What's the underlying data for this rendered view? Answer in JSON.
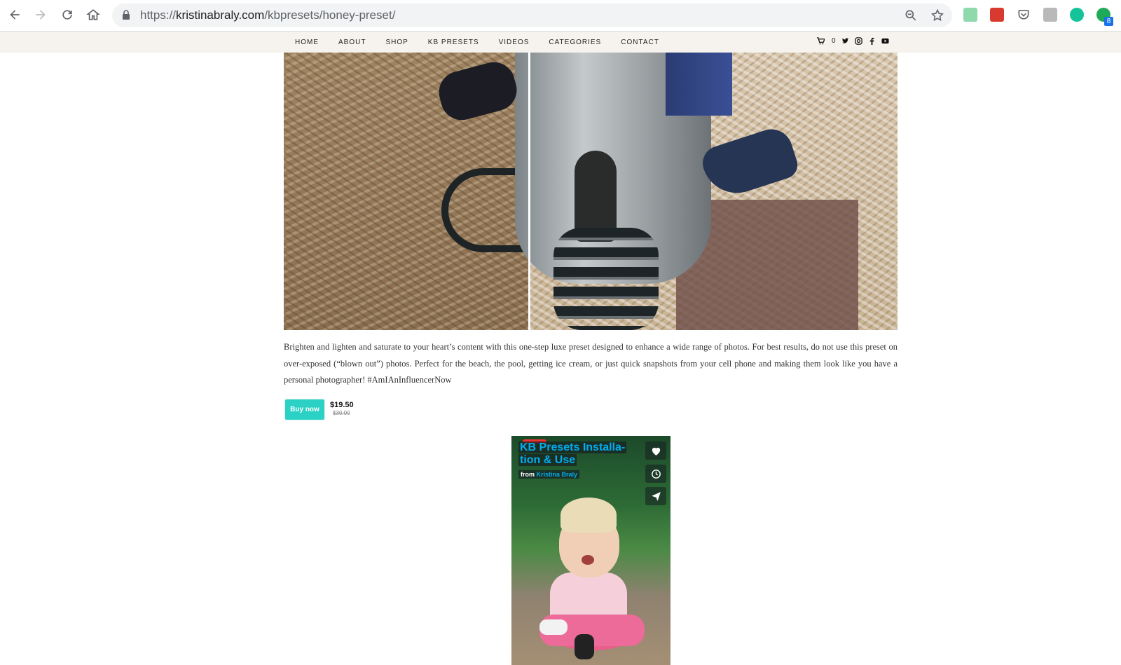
{
  "browser": {
    "url_host": "kristinabraly.com",
    "url_path": "/kbpresets/honey-preset/",
    "url_scheme": "https://",
    "extension_badge": "8"
  },
  "nav": {
    "items": [
      "HOME",
      "ABOUT",
      "SHOP",
      "KB PRESETS",
      "VIDEOS",
      "CATEGORIES",
      "CONTACT"
    ],
    "cart_count": "0"
  },
  "product": {
    "description": "Brighten and lighten and saturate to your heart’s content with this one-step luxe preset designed to enhance a wide range of photos. For best results, do not use this preset on over-exposed (“blown out”) photos. Perfect for the beach, the pool, getting ice cream, or just quick snapshots from your cell phone and making them look like you have a personal photographer! #AmIAnInfluencerNow",
    "buy_label": "Buy now",
    "price": "$19.50",
    "old_price": "$30.00"
  },
  "video": {
    "title_line1": "KB Presets Installa-",
    "title_line2": "tion & Use",
    "from_label": "from",
    "author": "Kristina Braly"
  },
  "colors": {
    "accent": "#2ad1c4",
    "nav_bg": "#f6f2ee",
    "vimeo_blue": "#00adef"
  }
}
